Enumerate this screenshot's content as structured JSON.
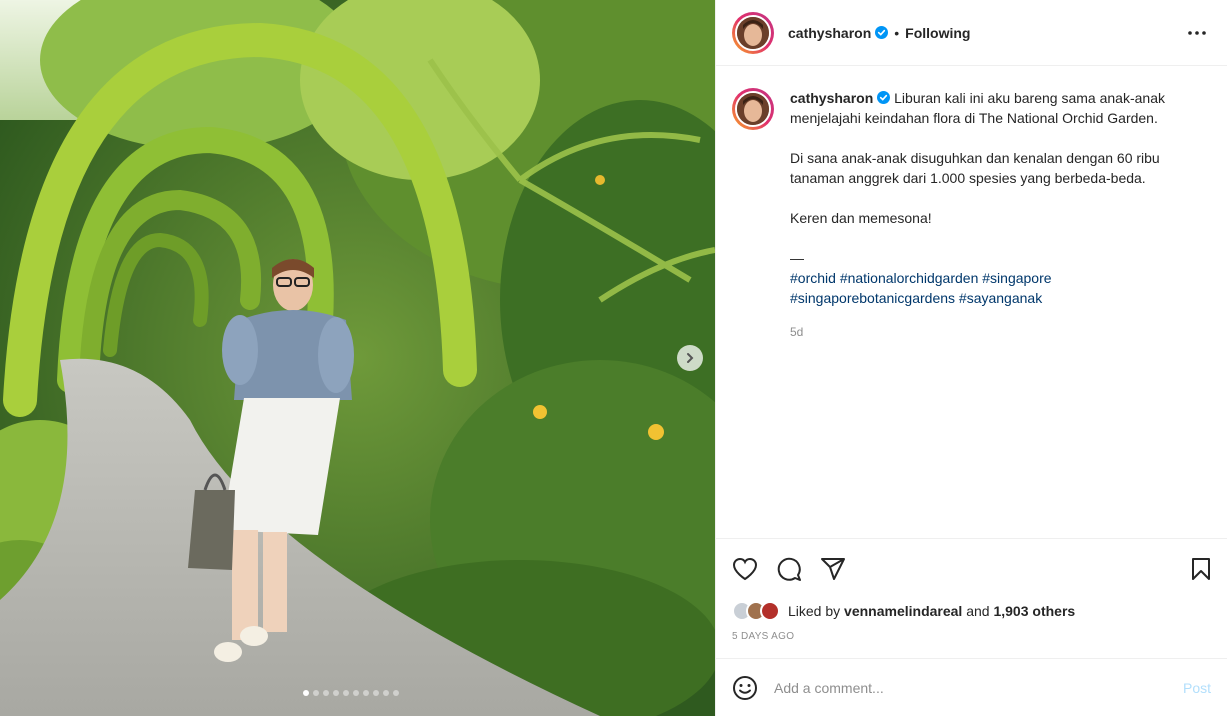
{
  "post": {
    "author": "cathysharon",
    "follow_status": "Following",
    "separator": "•",
    "icons": {
      "verified": "verified-badge-icon",
      "more": "more-options-icon",
      "next": "chevron-right-icon"
    },
    "carousel": {
      "slide_count": 10,
      "active_index": 0
    }
  },
  "caption": {
    "author": "cathysharon",
    "paragraphs": [
      "Liburan kali ini aku bareng sama anak-anak menjelajahi keindahan flora di The National Orchid Garden.",
      "Di sana anak-anak disuguhkan dan kenalan dengan 60 ribu tanaman anggrek dari 1.000 spesies yang berbeda-beda.",
      "Keren dan memesona!"
    ],
    "divider": "—",
    "hashtags_line1": [
      "#orchid",
      "#nationalorchidgarden",
      "#singapore"
    ],
    "hashtags_line2": [
      "#singaporebotanicgardens",
      "#sayanganak"
    ],
    "age": "5d"
  },
  "actions": {
    "icons": [
      "heart-icon",
      "comment-icon",
      "share-icon",
      "bookmark-icon"
    ],
    "liked_by_prefix": "Liked by",
    "liked_by_user": "vennamelindareal",
    "liked_by_and": "and",
    "liked_by_others": "1,903 others",
    "date": "5 DAYS AGO"
  },
  "comment_box": {
    "placeholder": "Add a comment...",
    "post_label": "Post",
    "icon": "emoji-icon"
  },
  "colors": {
    "link": "#00376b",
    "muted": "#8e8e8e",
    "post_disabled": "#b2dffc",
    "verified": "#0095f6"
  }
}
